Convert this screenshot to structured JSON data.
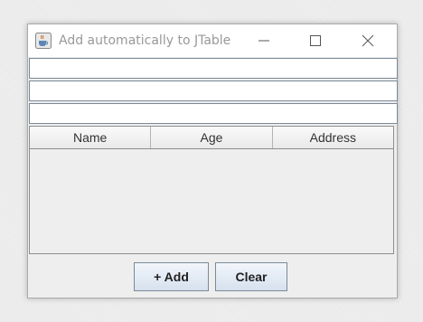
{
  "window": {
    "title": "Add automatically to JTable",
    "icon": "java-cup-icon",
    "controls": [
      "minimize-icon",
      "maximize-icon",
      "close-icon"
    ]
  },
  "form": {
    "fields": [
      {
        "value": "",
        "placeholder": ""
      },
      {
        "value": "",
        "placeholder": ""
      },
      {
        "value": "",
        "placeholder": ""
      }
    ]
  },
  "table": {
    "columns": [
      "Name",
      "Age",
      "Address"
    ],
    "rows": []
  },
  "buttons": {
    "add_label": "+ Add",
    "clear_label": "Clear"
  },
  "colors": {
    "title_text": "#999999",
    "button_top": "#f2f6fb",
    "button_bottom": "#d6e1ee",
    "border": "#7a8a99"
  }
}
